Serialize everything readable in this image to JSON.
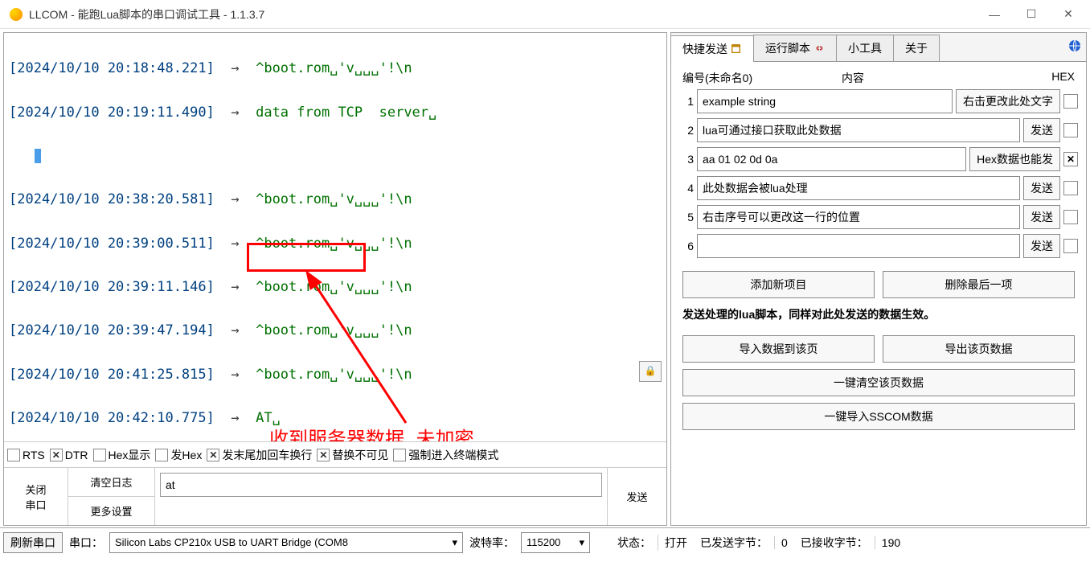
{
  "window": {
    "title": "LLCOM - 能跑Lua脚本的串口调试工具 - 1.1.3.7"
  },
  "log": {
    "lines": [
      {
        "ts": "[2024/10/10 20:18:48.221]",
        "arrow": "→",
        "text": "^boot.rom␣'v␣␣␣'!\\n"
      },
      {
        "ts": "[2024/10/10 20:19:11.490]",
        "arrow": "→",
        "text": "data from TCP  server␣"
      },
      {
        "ts": "",
        "arrow": "",
        "text": ""
      },
      {
        "ts": "[2024/10/10 20:38:20.581]",
        "arrow": "→",
        "text": "^boot.rom␣'v␣␣␣'!\\n"
      },
      {
        "ts": "[2024/10/10 20:39:00.511]",
        "arrow": "→",
        "text": "^boot.rom␣'v␣␣␣'!\\n"
      },
      {
        "ts": "[2024/10/10 20:39:11.146]",
        "arrow": "→",
        "text": "^boot.rom␣'v␣␣␣'!\\n"
      },
      {
        "ts": "[2024/10/10 20:39:47.194]",
        "arrow": "→",
        "text": "^boot.rom␣'v␣␣␣'!\\n"
      },
      {
        "ts": "[2024/10/10 20:41:25.815]",
        "arrow": "→",
        "text": "^boot.rom␣'v␣␣␣'!\\n"
      },
      {
        "ts": "[2024/10/10 20:42:10.775]",
        "arrow": "→",
        "text": "AT␣"
      }
    ]
  },
  "annotation": {
    "text": "收到服务器数据 未加密"
  },
  "checkbar": {
    "rts": {
      "label": "RTS",
      "checked": false
    },
    "dtr": {
      "label": "DTR",
      "checked": true
    },
    "hexshow": {
      "label": "Hex显示",
      "checked": false
    },
    "sendhex": {
      "label": "发Hex",
      "checked": false
    },
    "crlf": {
      "label": "发末尾加回车换行",
      "checked": true
    },
    "replace": {
      "label": "替换不可见",
      "checked": true
    },
    "terminal": {
      "label": "强制进入终端模式",
      "checked": false
    }
  },
  "leftbtns": {
    "close_port": "关闭\n串口",
    "clear_log": "清空日志",
    "more_settings": "更多设置",
    "send": "发送",
    "input_value": "at"
  },
  "tabs": {
    "quick": "快捷发送",
    "script": "运行脚本",
    "tools": "小工具",
    "about": "关于"
  },
  "quick": {
    "hdr_num": "编号",
    "hdr_name": "(未命名0)",
    "hdr_content": "内容",
    "hdr_hex": "HEX",
    "rows": [
      {
        "n": "1",
        "val": "example string",
        "btn": "右击更改此处文字",
        "hex": false
      },
      {
        "n": "2",
        "val": "lua可通过接口获取此处数据",
        "btn": "发送",
        "hex": false
      },
      {
        "n": "3",
        "val": "aa 01 02 0d 0a",
        "btn": "Hex数据也能发",
        "hex": true
      },
      {
        "n": "4",
        "val": "此处数据会被lua处理",
        "btn": "发送",
        "hex": false
      },
      {
        "n": "5",
        "val": "右击序号可以更改这一行的位置",
        "btn": "发送",
        "hex": false
      },
      {
        "n": "6",
        "val": "",
        "btn": "发送",
        "hex": false
      }
    ],
    "add_item": "添加新项目",
    "del_last": "删除最后一项",
    "note": "发送处理的lua脚本，同样对此处发送的数据生效。",
    "import_page": "导入数据到该页",
    "export_page": "导出该页数据",
    "clear_page": "一键清空该页数据",
    "import_sscom": "一键导入SSCOM数据"
  },
  "status": {
    "refresh": "刷新串口",
    "port_lbl": "串口：",
    "port_val": "Silicon Labs CP210x USB to UART Bridge (COM8",
    "baud_lbl": "波特率：",
    "baud_val": "115200",
    "state_lbl": "状态：",
    "state_val": "打开",
    "sent_lbl": "已发送字节：",
    "sent_val": "0",
    "recv_lbl": "已接收字节：",
    "recv_val": "190"
  }
}
